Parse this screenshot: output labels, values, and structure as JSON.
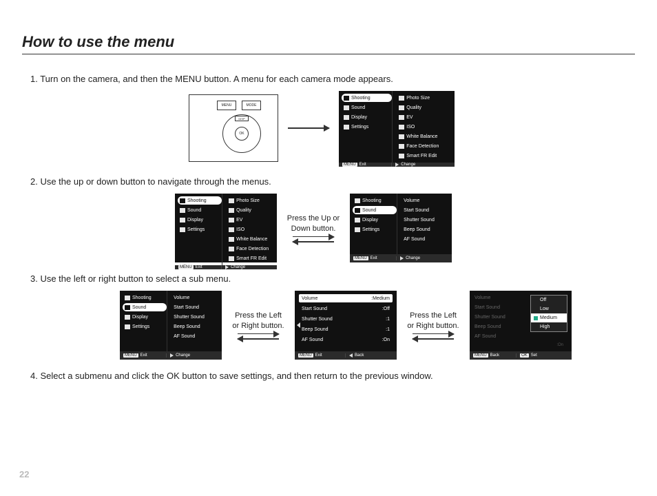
{
  "page": {
    "title": "How to use the menu",
    "page_number": "22"
  },
  "steps": {
    "s1": "1. Turn on the camera, and then the MENU button. A menu for each camera mode appears.",
    "s2": "2. Use the up or down button to navigate through the menus.",
    "s3": "3. Use the left or right button to select a sub menu.",
    "s4": "4. Select a submenu and click the OK button to save settings, and then return to the previous window."
  },
  "captions": {
    "updown": "Press the Up or Down button.",
    "leftright": "Press the Left or Right button."
  },
  "camera_buttons": {
    "menu": "MENU",
    "mode": "MODE",
    "ok": "OK",
    "disp": "DISP"
  },
  "footer_labels": {
    "menu_tag": "MENU",
    "ok_tag": "OK",
    "exit": "Exit",
    "change": "Change",
    "back": "Back",
    "set": "Set"
  },
  "tabs": {
    "shooting": "Shooting",
    "sound": "Sound",
    "display": "Display",
    "settings": "Settings"
  },
  "shooting_items": {
    "photo_size": "Photo Size",
    "quality": "Quality",
    "ev": "EV",
    "iso": "ISO",
    "wb": "White Balance",
    "face": "Face Detection",
    "smart": "Smart FR Edit"
  },
  "sound_items": {
    "volume": "Volume",
    "start_sound": "Start Sound",
    "shutter_sound": "Shutter Sound",
    "beep_sound": "Beep Sound",
    "af_sound": "AF Sound"
  },
  "sound_values": {
    "volume": ":Medium",
    "start_sound": ":Off",
    "shutter_sound": ":1",
    "beep_sound": ":1",
    "af_sound": ":On"
  },
  "volume_options": {
    "off": "Off",
    "low": "Low",
    "medium": "Medium",
    "high": "High"
  }
}
